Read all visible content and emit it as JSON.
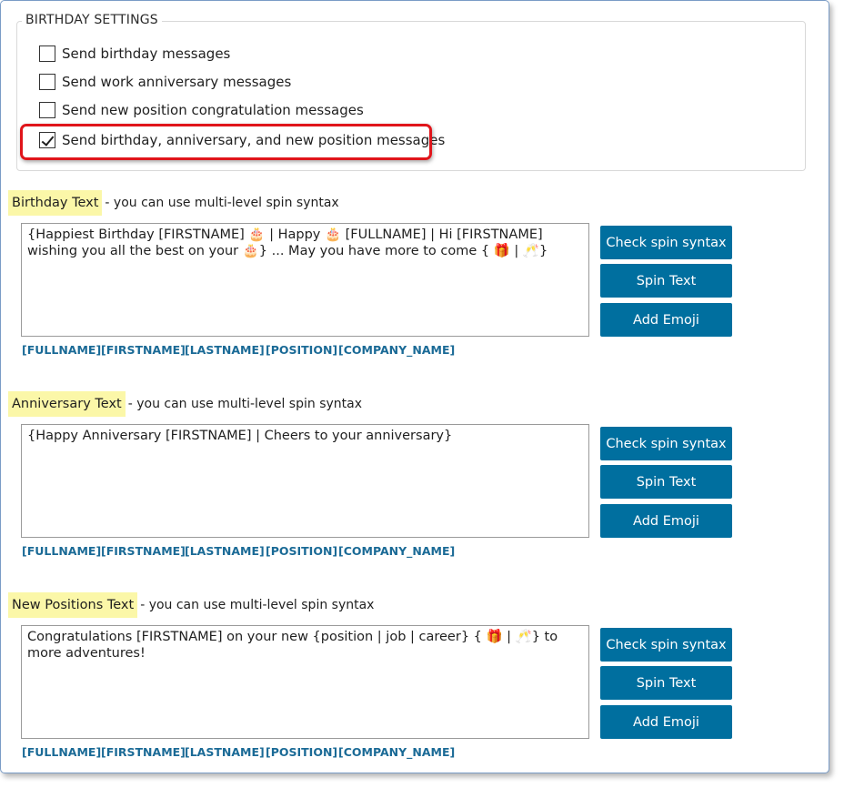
{
  "group_title": "BIRTHDAY SETTINGS",
  "checkboxes": [
    {
      "label": "Send birthday messages",
      "checked": false
    },
    {
      "label": "Send work anniversary messages",
      "checked": false
    },
    {
      "label": "Send new position congratulation messages",
      "checked": false
    },
    {
      "label": "Send birthday, anniversary, and new position messages",
      "checked": true
    }
  ],
  "sections": [
    {
      "title": "Birthday Text",
      "hint": "- you can use multi-level spin syntax",
      "text": "{Happiest Birthday [FIRSTNAME] 🎂 | Happy 🎂 [FULLNAME] | Hi [FIRSTNAME] wishing you all the best on your 🎂} ...  May you have more to come { 🎁 | 🥂}"
    },
    {
      "title": "Anniversary Text",
      "hint": "- you can use multi-level spin syntax",
      "text": "{Happy Anniversary [FIRSTNAME] | Cheers to your anniversary}"
    },
    {
      "title": "New Positions Text",
      "hint": "- you can use multi-level spin syntax",
      "text": "Congratulations [FIRSTNAME]  on your new {position | job | career} { 🎁 | 🥂} to more adventures!"
    }
  ],
  "buttons": {
    "check": "Check spin syntax",
    "spin": "Spin Text",
    "emoji": "Add Emoji"
  },
  "tokens": [
    "[FULLNAME]",
    "[FIRSTNAME]",
    "[LASTNAME]",
    "[POSITION]",
    "[COMPANY_NAME]"
  ],
  "colors": {
    "button": "#006f9f",
    "token": "#1a6a96",
    "label_highlight": "#fbf7a8",
    "annotation_box": "#e0151b"
  }
}
